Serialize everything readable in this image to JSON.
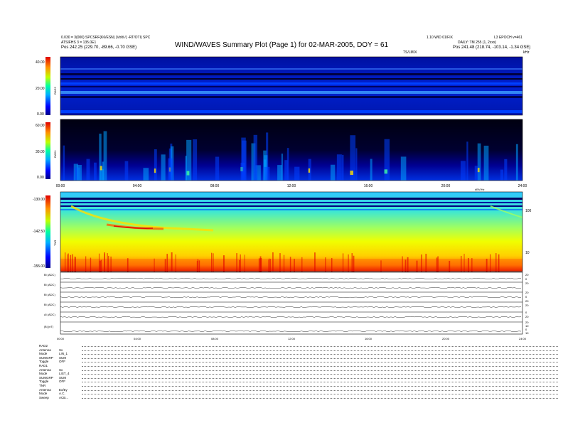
{
  "header": {
    "title": "WIND/WAVES Summary Plot (Page 1) for 02-MAR-2005, DOY = 61",
    "top_left_line1": "0.030 = 3(000) SPCSRF(K6/ESN) (Volt/√)  -RT/OTI) SPC",
    "top_left_line2": "ATSIFHS 3 = 135.0E1",
    "top_left_pos": "Pos  242.25 (229.70, -89.66, -0.70 GSE)",
    "top_right_line1": "1.10 WID 01/FIX",
    "top_right_line2": "L3 EPOCH v=461",
    "top_right_line3": "DAILY: TM 255 (1, 2xxx)",
    "top_right_pos": "Pos  241.48 (218.74, -103.14, -1.34 GSE)",
    "ts_label": "TS/LMIX",
    "khz_label": "kHz"
  },
  "panels": {
    "rad2": {
      "label": "RAD2",
      "ticks": [
        "40.00",
        "20.00",
        "0.00"
      ]
    },
    "rad1": {
      "label": "RAD1",
      "ticks": [
        "60.00",
        "30.00",
        "0.00"
      ]
    },
    "tnr": {
      "label": "TNR",
      "ticks": [
        "-130.00",
        "-142.50",
        "-155.00"
      ],
      "right_ticks": [
        "100",
        "10"
      ],
      "top_right": "dBV/Hz"
    },
    "time_ticks": [
      "00:00",
      "04:00",
      "08:00",
      "12:00",
      "16:00",
      "20:00",
      "24:00"
    ]
  },
  "lines": {
    "labels": [
      "Bi (ADC)",
      "Bi (ADC)",
      "Bi (ADC)",
      "Bi (ADC)",
      "Ai (ADC)",
      "|B| (nT)"
    ],
    "right_ticks": [
      "20",
      "0",
      "20",
      "20",
      "0",
      "20",
      "20",
      "0",
      "20",
      "20",
      "10",
      "0",
      "10"
    ]
  },
  "bottom_time_ticks": [
    "00:00",
    "04:00",
    "08:00",
    "12:00",
    "16:00",
    "20:00",
    "24:00"
  ],
  "settings": [
    {
      "k": "RAD2",
      "v": ""
    },
    {
      "k": "Antenna",
      "v": "Sx"
    },
    {
      "k": "Mode",
      "v": "LIN_1"
    },
    {
      "k": "SUMGRP",
      "v": "SUM"
    },
    {
      "k": "Toggle",
      "v": "OFF"
    },
    {
      "k": "RAD1",
      "v": ""
    },
    {
      "k": "Antenna",
      "v": "Sx"
    },
    {
      "k": "Mode",
      "v": "LIST_4"
    },
    {
      "k": "SUMGRP",
      "v": "SUM"
    },
    {
      "k": "Toggle",
      "v": "OFF"
    },
    {
      "k": "TNR",
      "v": ""
    },
    {
      "k": "Antenna",
      "v": "Ex/Ey"
    },
    {
      "k": "Mode",
      "v": "A.C."
    },
    {
      "k": "Sweep",
      "v": "ACB..."
    }
  ]
}
